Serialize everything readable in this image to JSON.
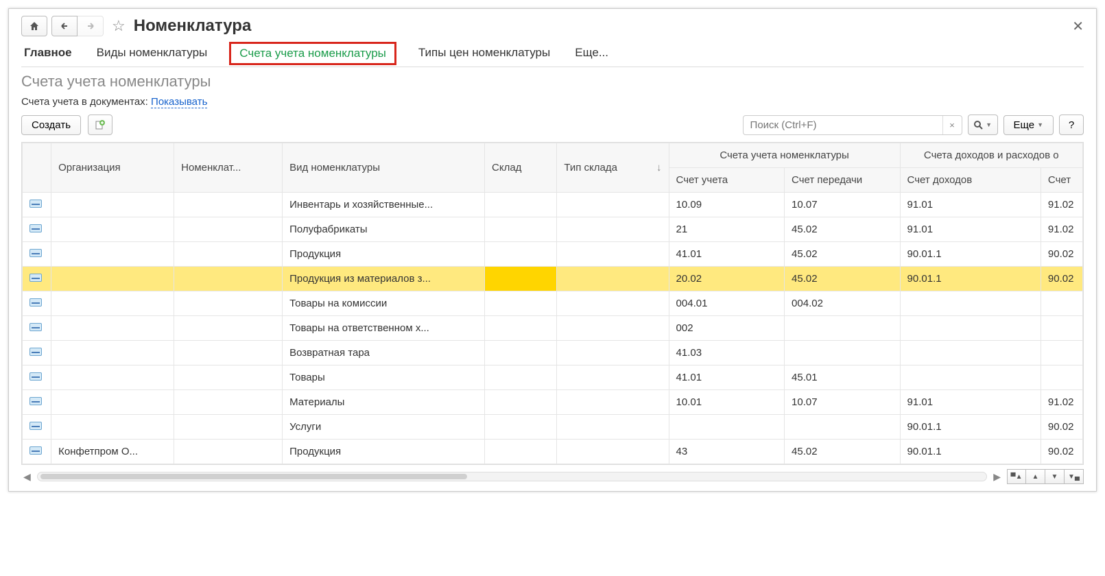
{
  "header": {
    "title": "Номенклатура"
  },
  "tabs": {
    "main": "Главное",
    "t1": "Виды номенклатуры",
    "t2": "Счета учета номенклатуры",
    "t3": "Типы цен номенклатуры",
    "t4": "Еще..."
  },
  "subtitle": "Счета учета номенклатуры",
  "linkrow": {
    "label": "Счета учета в документах:",
    "link": "Показывать"
  },
  "toolbar": {
    "create": "Создать",
    "search_placeholder": "Поиск (Ctrl+F)",
    "more": "Еще"
  },
  "columns": {
    "org": "Организация",
    "nomencl": "Номенклат...",
    "vid": "Вид номенклатуры",
    "sklad": "Склад",
    "tip_sklada": "Тип склада",
    "group_accounts": "Счета учета номенклатуры",
    "schet_ucheta": "Счет учета",
    "schet_peredachi": "Счет передачи",
    "group_income": "Счета доходов и расходов о",
    "schet_dohodov": "Счет доходов",
    "schet_last": "Счет"
  },
  "rows": [
    {
      "org": "",
      "vid": "Инвентарь и хозяйственные...",
      "s1": "10.09",
      "s2": "10.07",
      "s3": "91.01",
      "s4": "91.02",
      "sel": false
    },
    {
      "org": "",
      "vid": "Полуфабрикаты",
      "s1": "21",
      "s2": "45.02",
      "s3": "91.01",
      "s4": "91.02",
      "sel": false
    },
    {
      "org": "",
      "vid": "Продукция",
      "s1": "41.01",
      "s2": "45.02",
      "s3": "90.01.1",
      "s4": "90.02",
      "sel": false
    },
    {
      "org": "",
      "vid": "Продукция из материалов з...",
      "s1": "20.02",
      "s2": "45.02",
      "s3": "90.01.1",
      "s4": "90.02",
      "sel": true
    },
    {
      "org": "",
      "vid": "Товары на комиссии",
      "s1": "004.01",
      "s2": "004.02",
      "s3": "",
      "s4": "",
      "sel": false
    },
    {
      "org": "",
      "vid": "Товары на ответственном х...",
      "s1": "002",
      "s2": "",
      "s3": "",
      "s4": "",
      "sel": false
    },
    {
      "org": "",
      "vid": "Возвратная тара",
      "s1": "41.03",
      "s2": "",
      "s3": "",
      "s4": "",
      "sel": false
    },
    {
      "org": "",
      "vid": "Товары",
      "s1": "41.01",
      "s2": "45.01",
      "s3": "",
      "s4": "",
      "sel": false
    },
    {
      "org": "",
      "vid": "Материалы",
      "s1": "10.01",
      "s2": "10.07",
      "s3": "91.01",
      "s4": "91.02",
      "sel": false
    },
    {
      "org": "",
      "vid": "Услуги",
      "s1": "",
      "s2": "",
      "s3": "90.01.1",
      "s4": "90.02",
      "sel": false
    },
    {
      "org": "Конфетпром О...",
      "vid": "Продукция",
      "s1": "43",
      "s2": "45.02",
      "s3": "90.01.1",
      "s4": "90.02",
      "sel": false
    }
  ]
}
